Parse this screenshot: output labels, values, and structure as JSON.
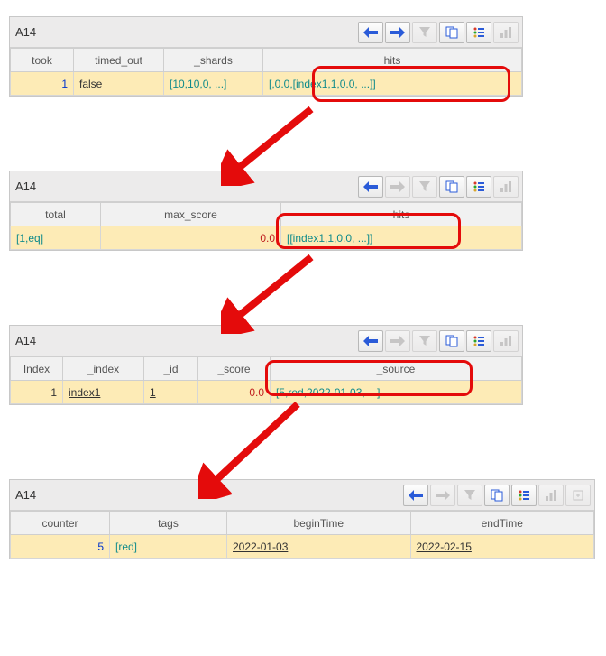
{
  "panels": [
    {
      "title": "A14",
      "columns": [
        "took",
        "timed_out",
        "_shards",
        "hits"
      ],
      "row": {
        "took": "1",
        "timed_out": "false",
        "shards": "[10,10,0, ...]",
        "hits": "[,0.0,[index1,1,0.0, ...]]"
      }
    },
    {
      "title": "A14",
      "columns": [
        "total",
        "max_score",
        "hits"
      ],
      "row": {
        "total": "[1,eq]",
        "max_score": "0.0",
        "hits": "[[index1,1,0.0, ...]]"
      }
    },
    {
      "title": "A14",
      "columns": [
        "Index",
        "_index",
        "_id",
        "_score",
        "_source"
      ],
      "row": {
        "index": "1",
        "_index": "index1",
        "_id": "1",
        "_score": "0.0",
        "_source": "[5,red,2022-01-03, ...]"
      }
    },
    {
      "title": "A14",
      "columns": [
        "counter",
        "tags",
        "beginTime",
        "endTime"
      ],
      "row": {
        "counter": "5",
        "tags": "[red]",
        "beginTime": "2022-01-03",
        "endTime": "2022-02-15"
      }
    }
  ],
  "buttons": {
    "back": "←",
    "fwd": "→",
    "filter": "filter",
    "copy": "copy",
    "list": "list",
    "chart": "chart",
    "export": "export"
  }
}
